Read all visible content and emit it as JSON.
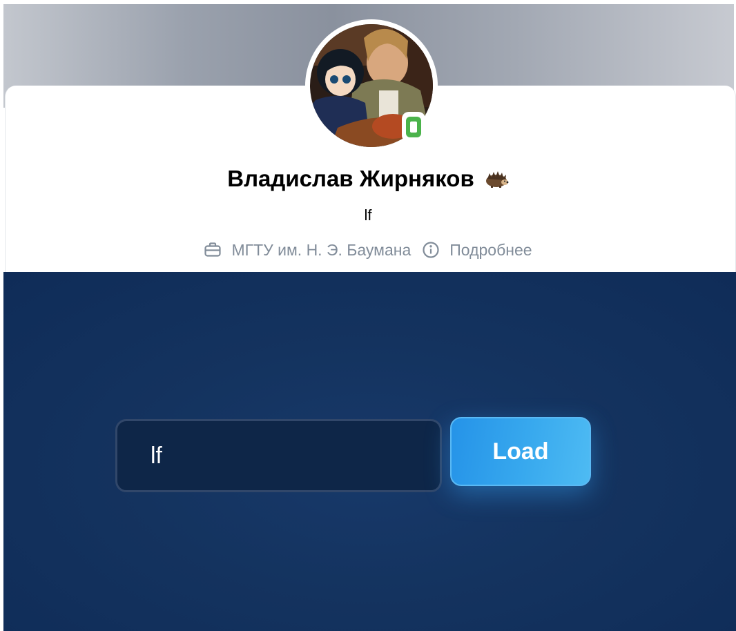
{
  "profile": {
    "name": "Владислав Жирняков",
    "name_emoji": "hedgehog-emoji-icon",
    "status": "lf",
    "online_indicator": "mobile-online-icon",
    "info": [
      {
        "icon": "briefcase-icon",
        "label": "МГТУ им. Н. Э. Баумана"
      },
      {
        "icon": "info-circle-icon",
        "label": "Подробнее"
      }
    ]
  },
  "loader": {
    "input_value": "lf",
    "button_label": "Load"
  },
  "colors": {
    "online": "#4bb34b",
    "info_text": "#818c99",
    "stage_bg": "#14335f",
    "input_bg": "#0e2648",
    "button_start": "#2593e8",
    "button_end": "#4ebbf3"
  }
}
